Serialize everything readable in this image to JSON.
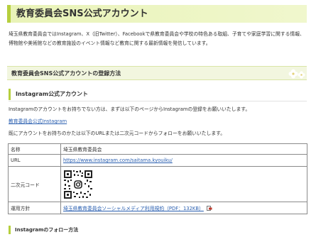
{
  "page": {
    "title": "教育委員会SNS公式アカウント",
    "intro": "埼玉県教育委員会ではInstagram、X（旧Twitter）、Facebookで県教育委員会や学校の特色ある取組、子育てや家庭学習に関する情報、博物館や美術館などの教育施設のイベント情報など教育に関する最新情報を発信しています。"
  },
  "section": {
    "heading": "教育委員会SNS公式アカウントの登録方法",
    "subheading": "Instagram公式アカウント",
    "text1": "Instagramのアカウントをお持ちでない方は、まずは以下のページからInstagramの登録をお願いいたします。",
    "link": "教育委員会公式Instagram",
    "text2": "既にアカウントをお持ちのかたは以下のURLまたは二次元コードからフォローをお願いいたします。"
  },
  "table": {
    "rows": [
      {
        "label": "名称",
        "value": "埼玉県教育委員会"
      },
      {
        "label": "URL",
        "value": "https://www.instagram.com/saitama.kyouiku/"
      },
      {
        "label": "二次元コード",
        "value": ""
      },
      {
        "label": "運用方針",
        "value": "埼玉県教育委員会ソーシャルメディア利用規約（PDF：132KB）"
      }
    ]
  },
  "next_section": {
    "heading": "Instagramのフォロー方法"
  },
  "colors": {
    "accent": "#b6cf3e",
    "link": "#2a5fb0",
    "title_bg": "#e9f3b8"
  },
  "icons": {
    "flower": "flower-icon",
    "qr": "qr-code-icon",
    "pdf": "pdf-external-icon"
  }
}
